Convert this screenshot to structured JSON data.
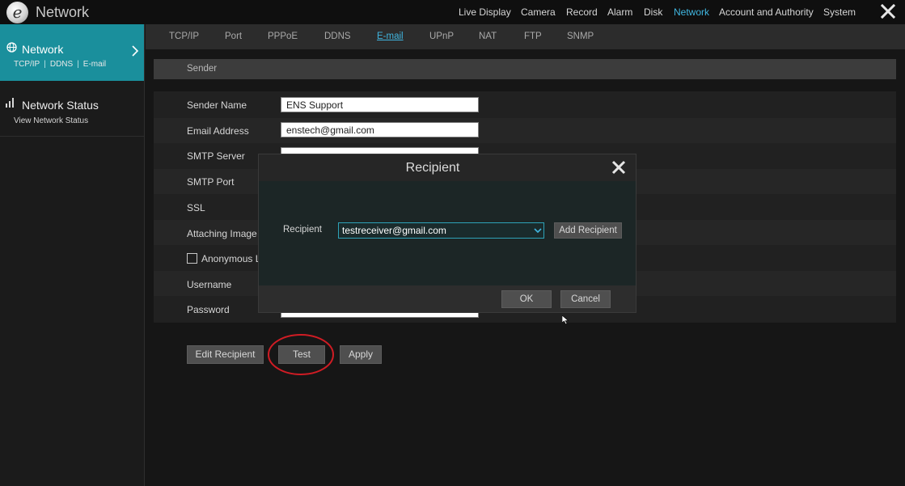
{
  "app": {
    "title": "Network"
  },
  "top_nav": [
    {
      "label": "Live Display",
      "active": false
    },
    {
      "label": "Camera",
      "active": false
    },
    {
      "label": "Record",
      "active": false
    },
    {
      "label": "Alarm",
      "active": false
    },
    {
      "label": "Disk",
      "active": false
    },
    {
      "label": "Network",
      "active": true
    },
    {
      "label": "Account and Authority",
      "active": false
    },
    {
      "label": "System",
      "active": false
    }
  ],
  "sidebar": {
    "items": [
      {
        "title": "Network",
        "subs": [
          "TCP/IP",
          "DDNS",
          "E-mail"
        ],
        "active": true
      },
      {
        "title": "Network Status",
        "sub": "View Network Status",
        "active": false
      }
    ]
  },
  "tabs": [
    {
      "label": "TCP/IP",
      "active": false
    },
    {
      "label": "Port",
      "active": false
    },
    {
      "label": "PPPoE",
      "active": false
    },
    {
      "label": "DDNS",
      "active": false
    },
    {
      "label": "E-mail",
      "active": true
    },
    {
      "label": "UPnP",
      "active": false
    },
    {
      "label": "NAT",
      "active": false
    },
    {
      "label": "FTP",
      "active": false
    },
    {
      "label": "SNMP",
      "active": false
    }
  ],
  "sender": {
    "header": "Sender",
    "fields": {
      "sender_name": {
        "label": "Sender Name",
        "value": "ENS Support"
      },
      "email_address": {
        "label": "Email Address",
        "value": "enstech@gmail.com"
      },
      "smtp_server": {
        "label": "SMTP Server",
        "value": ""
      },
      "smtp_port": {
        "label": "SMTP Port"
      },
      "ssl": {
        "label": "SSL"
      },
      "attaching_image": {
        "label": "Attaching Image"
      },
      "anonymous": {
        "label": "Anonymous L",
        "checked": false
      },
      "username": {
        "label": "Username"
      },
      "password": {
        "label": "Password",
        "value": ""
      }
    }
  },
  "buttons": {
    "edit_recipient": "Edit Recipient",
    "test": "Test",
    "apply": "Apply"
  },
  "recipient_dialog": {
    "title": "Recipient",
    "label": "Recipient",
    "value": "testreceiver@gmail.com",
    "add_button": "Add Recipient",
    "ok": "OK",
    "cancel": "Cancel"
  },
  "colors": {
    "accent": "#40b6e0",
    "sidebar_active": "#1a8f9c",
    "annotation": "#d01c24"
  }
}
